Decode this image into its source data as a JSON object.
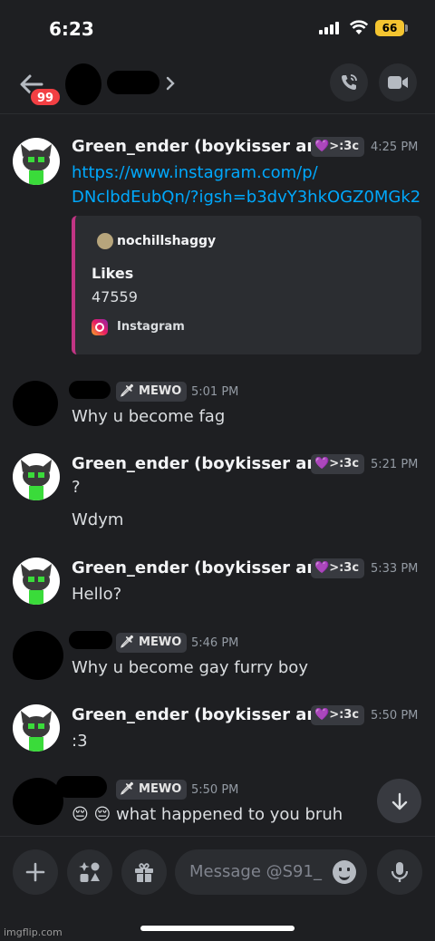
{
  "status_bar": {
    "time": "6:23",
    "battery": "66"
  },
  "header": {
    "unread_badge": "99"
  },
  "messages": [
    {
      "author": "Green_ender (boykisser ark)",
      "tag": ">:3c",
      "time": "4:25 PM",
      "lines": [
        "https://www.instagram.com/p/",
        "DNclbdEubQn/?igsh=b3dvY3hkOGZ0MGk2"
      ],
      "embed": {
        "author": "nochillshaggy",
        "title": "Likes",
        "value": "47559",
        "provider": "Instagram",
        "accent": "#c13584"
      }
    },
    {
      "author": "",
      "tag": "MEWO",
      "time": "5:01 PM",
      "lines": [
        "Why u become fag"
      ]
    },
    {
      "author": "Green_ender (boykisser ark)",
      "tag": ">:3c",
      "time": "5:21 PM",
      "lines": [
        "?",
        "Wdym"
      ]
    },
    {
      "author": "Green_ender (boykisser ark)",
      "tag": ">:3c",
      "time": "5:33 PM",
      "lines": [
        "Hello?"
      ]
    },
    {
      "author": "",
      "tag": "MEWO",
      "time": "5:46 PM",
      "lines": [
        "Why u become gay furry boy"
      ]
    },
    {
      "author": "Green_ender (boykisser ark)",
      "tag": ">:3c",
      "time": "5:50 PM",
      "lines": [
        ":3"
      ]
    },
    {
      "author": "",
      "tag": "MEWO",
      "time": "5:50 PM",
      "lines": [
        "😔 😔 what happened to you bruh"
      ]
    }
  ],
  "composer": {
    "placeholder": "Message @S91_"
  },
  "watermark": "imgflip.com",
  "colors": {
    "link": "#00a8fc",
    "badge": "#f23f43",
    "battery": "#f4c430",
    "background": "#1e1f22"
  },
  "icons": [
    "back-arrow-icon",
    "chevron-right-icon",
    "phone-call-icon",
    "video-call-icon",
    "plus-icon",
    "apps-icon",
    "gift-icon",
    "emoji-icon",
    "microphone-icon",
    "arrow-down-icon"
  ]
}
